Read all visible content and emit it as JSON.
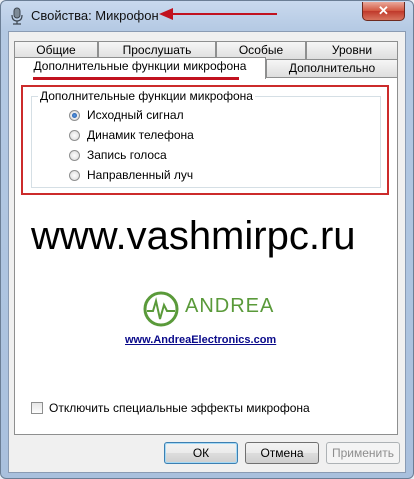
{
  "window": {
    "title": "Свойства: Микрофон",
    "close_label": "✕"
  },
  "tabs": {
    "row1": [
      "Общие",
      "Прослушать",
      "Особые",
      "Уровни"
    ],
    "row2": [
      "Дополнительные функции микрофона",
      "Дополнительно"
    ],
    "active": "Дополнительные функции микрофона"
  },
  "group": {
    "label": "Дополнительные функции микрофона",
    "options": [
      {
        "label": "Исходный сигнал",
        "checked": true
      },
      {
        "label": "Динамик телефона",
        "checked": false
      },
      {
        "label": "Запись голоса",
        "checked": false
      },
      {
        "label": "Направленный луч",
        "checked": false
      }
    ]
  },
  "watermark": "www.vashmirpc.ru",
  "logo": {
    "brand": "ANDREA",
    "link": "www.AndreaElectronics.com",
    "color": "#5a9a3a"
  },
  "disable_effects": {
    "label": "Отключить специальные эффекты микрофона",
    "checked": false
  },
  "buttons": {
    "ok": "ОК",
    "cancel": "Отмена",
    "apply": "Применить"
  },
  "colors": {
    "highlight": "#cc2b2b",
    "accent_arrow": "#c1121f"
  }
}
